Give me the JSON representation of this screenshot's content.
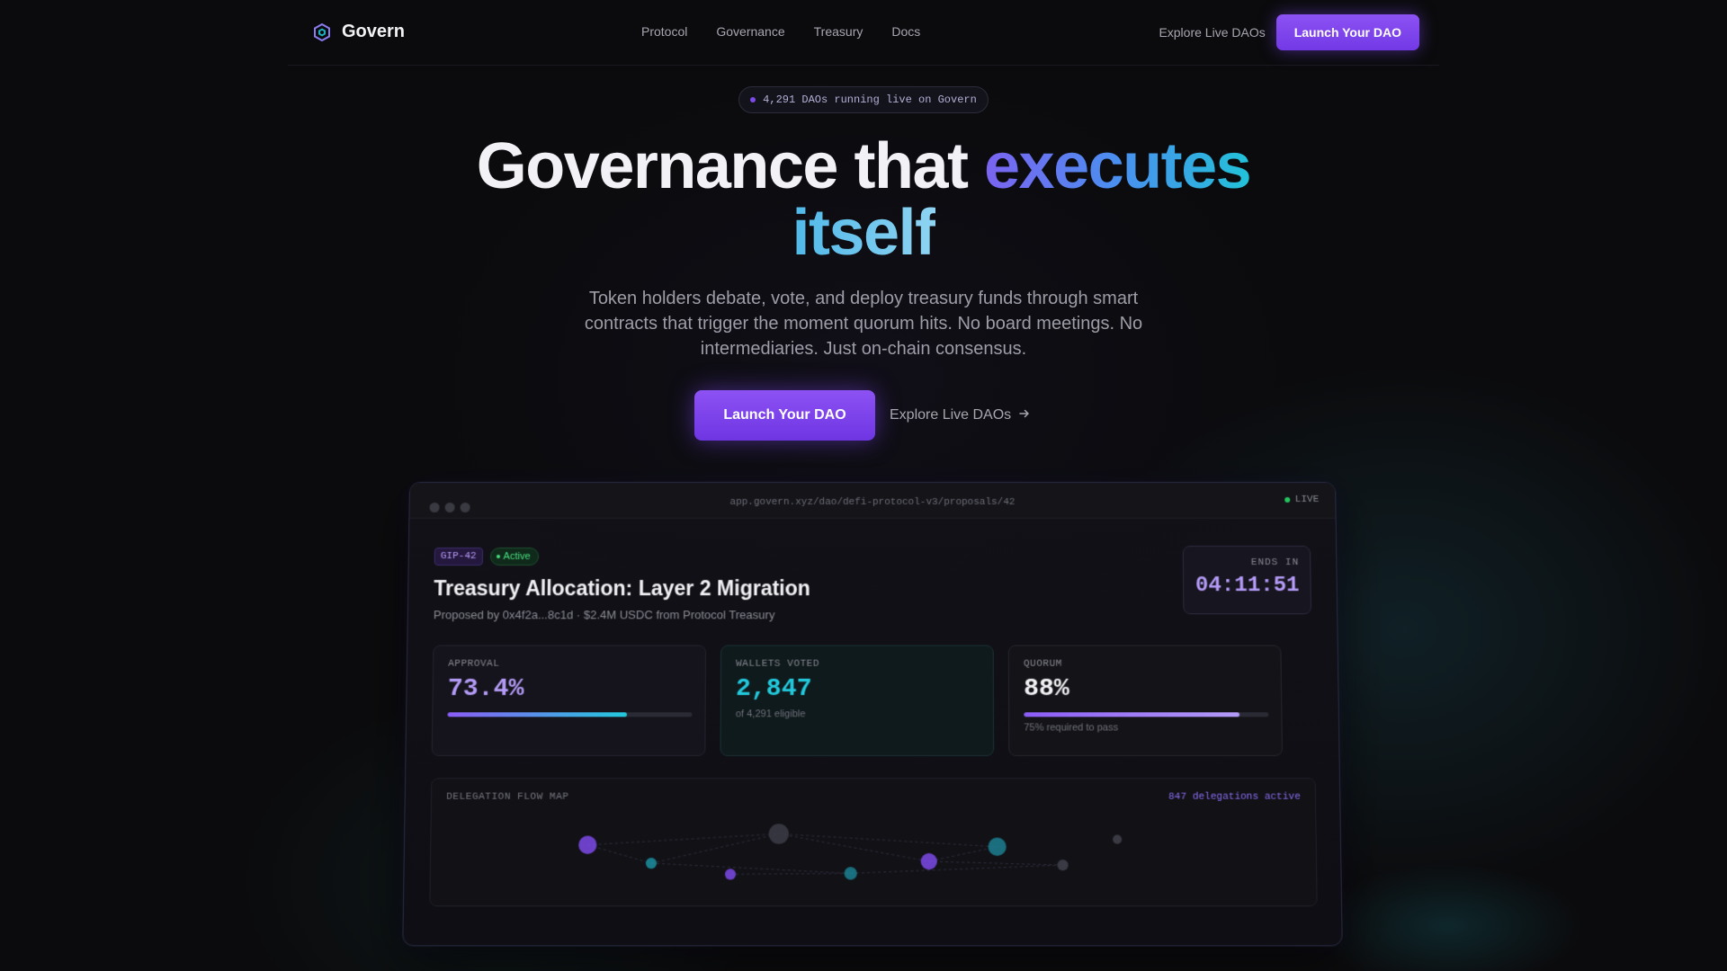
{
  "brand": {
    "name": "Govern",
    "icon": "hexagon-logo-icon"
  },
  "nav": {
    "links": [
      "Protocol",
      "Governance",
      "Treasury",
      "Docs"
    ],
    "explore": "Explore Live DAOs",
    "launch": "Launch Your DAO"
  },
  "hero": {
    "pill": "4,291 DAOs running live on Govern",
    "headline_plain": "Governance that",
    "headline_accent": "executes",
    "headline_line2": "itself",
    "subtext": "Token holders debate, vote, and deploy treasury funds through smart contracts that trigger the moment quorum hits. No board meetings. No intermediaries. Just on-chain consensus.",
    "cta_primary": "Launch Your DAO",
    "cta_secondary": "Explore Live DAOs",
    "cta_secondary_icon": "arrow-right-icon"
  },
  "dashboard": {
    "url": "app.govern.xyz/dao/defi-protocol-v3/proposals/42",
    "live": "LIVE",
    "tag_id": "GIP-42",
    "tag_status": "Active",
    "title": "Treasury Allocation: Layer 2 Migration",
    "meta": "Proposed by 0x4f2a...8c1d · $2.4M USDC from Protocol Treasury",
    "ends_label": "ENDS IN",
    "ends_time": "04:11:51",
    "stats": {
      "approval": {
        "label": "APPROVAL",
        "value": "73.4%",
        "fill": 0.734
      },
      "wallets": {
        "label": "WALLETS VOTED",
        "value": "2,847",
        "sub": "of 4,291 eligible"
      },
      "quorum": {
        "label": "QUORUM",
        "value": "88%",
        "fill": 0.88,
        "sub": "75% required to pass"
      }
    },
    "flow": {
      "label": "DELEGATION FLOW MAP",
      "active": "847 delegations active"
    }
  },
  "colors": {
    "accent": "#7c4ae8",
    "teal": "#22c9dc",
    "live_green": "#22c55e"
  }
}
